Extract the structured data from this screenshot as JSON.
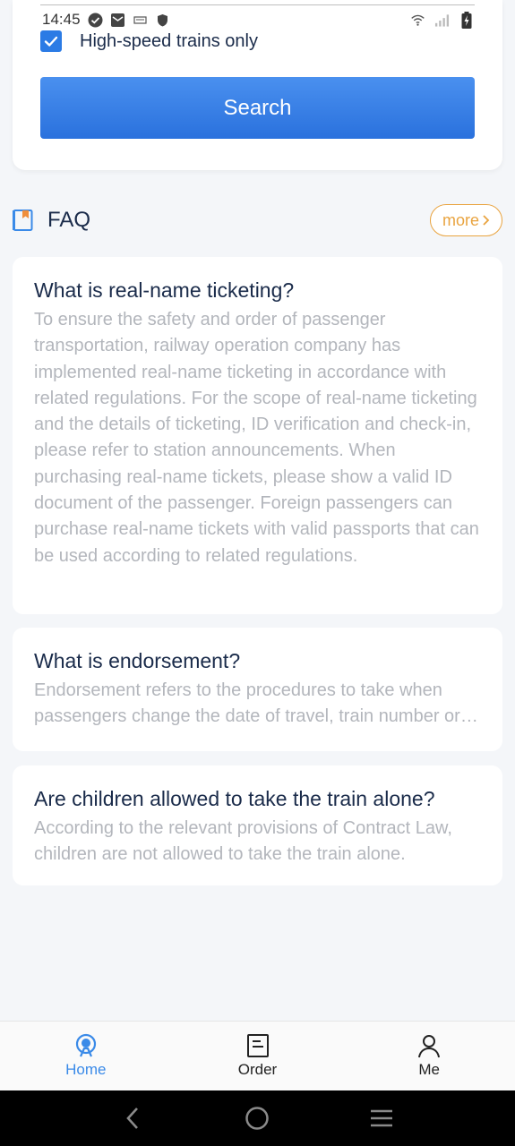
{
  "status_bar": {
    "time": "14:45"
  },
  "search": {
    "checkbox_label": "High-speed trains only",
    "checkbox_checked": true,
    "button_label": "Search"
  },
  "faq": {
    "title": "FAQ",
    "more_label": "more",
    "items": [
      {
        "question": "What is real-name ticketing?",
        "answer": "To ensure the safety and order of passenger transportation, railway operation company has implemented real-name ticketing in accordance with related regulations. For the scope of real-name ticketing and the details of ticketing, ID verification and check-in, please refer to station announcements. When purchasing real-name tickets, please show a valid ID document of the passenger. Foreign passengers can purchase real-name tickets with valid passports that can be used according to related regulations."
      },
      {
        "question": "What is endorsement?",
        "answer": "Endorsement refers to the procedures to take when passengers change the date of travel, train number or seat class."
      },
      {
        "question": "Are children allowed to take the train alone?",
        "answer": "According to the relevant provisions of Contract Law, children are not allowed to take the train alone."
      }
    ]
  },
  "bottom_nav": {
    "items": [
      {
        "label": "Home",
        "icon": "home-train-icon",
        "active": true
      },
      {
        "label": "Order",
        "icon": "order-icon",
        "active": false
      },
      {
        "label": "Me",
        "icon": "person-icon",
        "active": false
      }
    ]
  },
  "colors": {
    "accent": "#2b7be5",
    "more_orange": "#e9a440",
    "active_nav": "#3a8ae8"
  }
}
